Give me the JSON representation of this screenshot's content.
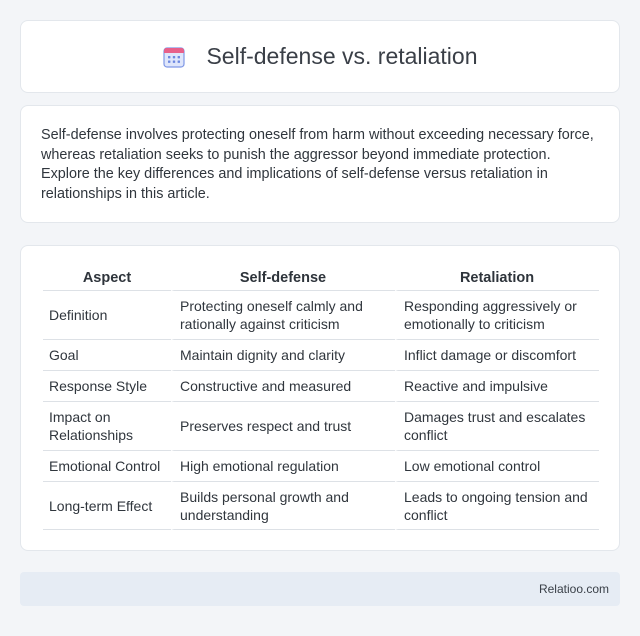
{
  "header": {
    "title": "Self-defense vs. retaliation",
    "icon": "calendar-icon"
  },
  "intro": {
    "text": "Self-defense involves protecting oneself from harm without exceeding necessary force, whereas retaliation seeks to punish the aggressor beyond immediate protection. Explore the key differences and implications of self-defense versus retaliation in relationships in this article."
  },
  "table": {
    "headers": [
      "Aspect",
      "Self-defense",
      "Retaliation"
    ],
    "rows": [
      [
        "Definition",
        "Protecting oneself calmly and rationally against criticism",
        "Responding aggressively or emotionally to criticism"
      ],
      [
        "Goal",
        "Maintain dignity and clarity",
        "Inflict damage or discomfort"
      ],
      [
        "Response Style",
        "Constructive and measured",
        "Reactive and impulsive"
      ],
      [
        "Impact on Relationships",
        "Preserves respect and trust",
        "Damages trust and escalates conflict"
      ],
      [
        "Emotional Control",
        "High emotional regulation",
        "Low emotional control"
      ],
      [
        "Long-term Effect",
        "Builds personal growth and understanding",
        "Leads to ongoing tension and conflict"
      ]
    ]
  },
  "footer": {
    "brand": "Relatioo.com"
  },
  "colors": {
    "background": "#f3f5f8",
    "card": "#ffffff",
    "footer_bg": "#e6ecf4",
    "icon_blue": "#5b7fe0",
    "icon_pink": "#e8608a"
  }
}
